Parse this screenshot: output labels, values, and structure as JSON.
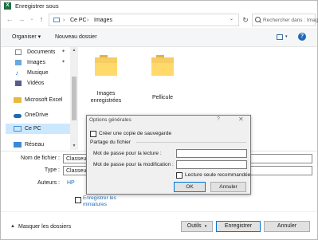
{
  "window": {
    "title": "Enregistrer sous",
    "app_logo": "X"
  },
  "address": {
    "crumbs": [
      "Ce PC",
      "Images"
    ],
    "separator": "›",
    "search_placeholder": "Rechercher dans : Images"
  },
  "toolbar": {
    "organize_label": "Organiser ▾",
    "new_folder_label": "Nouveau dossier"
  },
  "nav": {
    "items": [
      {
        "label": "Documents",
        "icon": "documents-icon",
        "pinned": true
      },
      {
        "label": "Images",
        "icon": "images-icon",
        "pinned": true
      },
      {
        "label": "Musique",
        "icon": "music-icon",
        "pinned": false
      },
      {
        "label": "Vidéos",
        "icon": "videos-icon",
        "pinned": false
      },
      {
        "label": "Microsoft Excel",
        "icon": "excel-icon",
        "pinned": false
      },
      {
        "label": "OneDrive",
        "icon": "onedrive-icon",
        "pinned": false
      },
      {
        "label": "Ce PC",
        "icon": "pc-icon",
        "pinned": false,
        "selected": true
      },
      {
        "label": "Réseau",
        "icon": "network-icon",
        "pinned": false
      }
    ]
  },
  "folders": [
    {
      "label_line1": "Images",
      "label_line2": "enregistrées"
    },
    {
      "label_line1": "Pellicule",
      "label_line2": ""
    }
  ],
  "fields": {
    "filename_label": "Nom de fichier :",
    "filename_value": "Classeur1",
    "type_label": "Type :",
    "type_value": "Classeur Excel",
    "authors_label": "Auteurs :",
    "authors_value": "HP",
    "thumbnails_label_line1": "Enregistrer les",
    "thumbnails_label_line2": "miniatures"
  },
  "footer": {
    "hide_folders_label": "Masquer les dossiers",
    "tools_label": "Outils",
    "save_label": "Enregistrer",
    "cancel_label": "Annuler"
  },
  "options_dialog": {
    "title": "Options générales",
    "help": "?",
    "close": "✕",
    "backup_label": "Créer une copie de sauvegarde",
    "sharing_label": "Partage du fichier",
    "open_password_label": "Mot de passe pour la lecture :",
    "modify_password_label": "Mot de passe pour la modification :",
    "read_only_label": "Lecture seule recommandée",
    "ok_label": "OK",
    "cancel_label": "Annuler"
  },
  "colors": {
    "accent": "#1f6ab5",
    "selection": "#cce8ff",
    "folder": "#f6cd62"
  }
}
